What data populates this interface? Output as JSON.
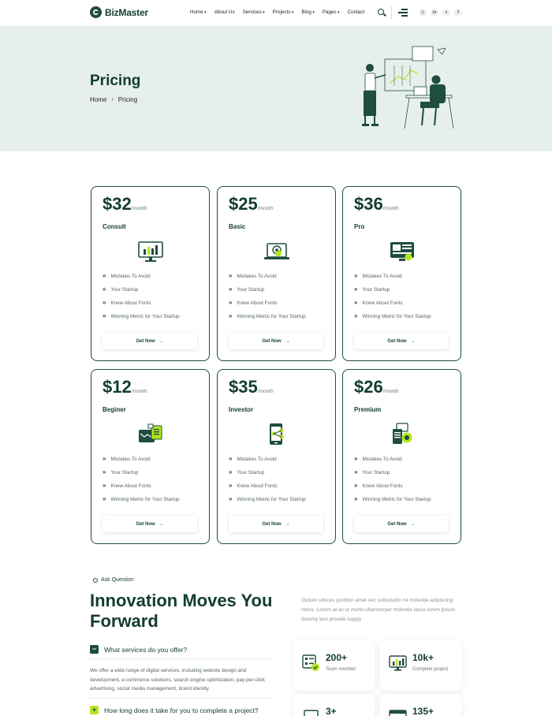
{
  "header": {
    "logo": "BizMaster",
    "nav": [
      "Home",
      "About Us",
      "Services",
      "Projects",
      "Blog",
      "Pages",
      "Contact"
    ],
    "nav_dropdowns": [
      true,
      false,
      true,
      true,
      true,
      true,
      false
    ],
    "socials": [
      "instagram-icon",
      "linkedin-icon",
      "twitter-icon",
      "facebook-icon"
    ],
    "social_glyphs": [
      "◎",
      "in",
      "t",
      "f"
    ]
  },
  "hero": {
    "title": "Pricing",
    "breadcrumb": [
      "Home",
      "Pricing"
    ],
    "breadcrumb_sep": "›"
  },
  "pricing": {
    "per": "/month",
    "button": "Get Now",
    "button_arrow": "→",
    "features": [
      "Mistakes To Avoid",
      "Your Startup",
      "Knew About Fonts",
      "Winning Metric for Your Startup"
    ],
    "plans": [
      {
        "price": "$32",
        "name": "Consult",
        "icon": "monitor-chart-icon"
      },
      {
        "price": "$25",
        "name": "Basic",
        "icon": "laptop-gear-icon"
      },
      {
        "price": "$36",
        "name": "Pro",
        "icon": "dashboard-icon"
      },
      {
        "price": "$12",
        "name": "Beginer",
        "icon": "wallet-document-icon"
      },
      {
        "price": "$35",
        "name": "Investor",
        "icon": "tablet-share-icon"
      },
      {
        "price": "$26",
        "name": "Premium",
        "icon": "document-badge-icon"
      }
    ]
  },
  "faq": {
    "tag": "Ask Question",
    "title": "Innovation Moves You Forward",
    "description": "Dictum ultrices porttitor amet nec sollicitudin mi molestie adipiscing netus. Lorem at ac ut morbi ullamcorper molestie lacus lorem ipsum dummy text provide happy",
    "items": [
      {
        "question": "What services do you offer?",
        "toggle": "−",
        "open": true,
        "answer": "We offer a wide range of digital services, including website design and development, e-commerce solutions, search engine optimization, pay-per-click advertising, social media management, brand identity"
      },
      {
        "question": "How long does it take for you to complete a project?",
        "toggle": "+",
        "open": false
      }
    ]
  },
  "stats": [
    {
      "value": "200+",
      "label": "Team member",
      "icon": "team-checklist-icon"
    },
    {
      "value": "10k+",
      "label": "Complete project",
      "icon": "monitor-chart-icon"
    },
    {
      "value": "3+",
      "label": "",
      "icon": "laptop-icon"
    },
    {
      "value": "135+",
      "label": "",
      "icon": "browser-icon"
    }
  ],
  "colors": {
    "primary": "#1f4d40",
    "accent": "#b5e61d",
    "hero_bg": "#e6efeb"
  }
}
